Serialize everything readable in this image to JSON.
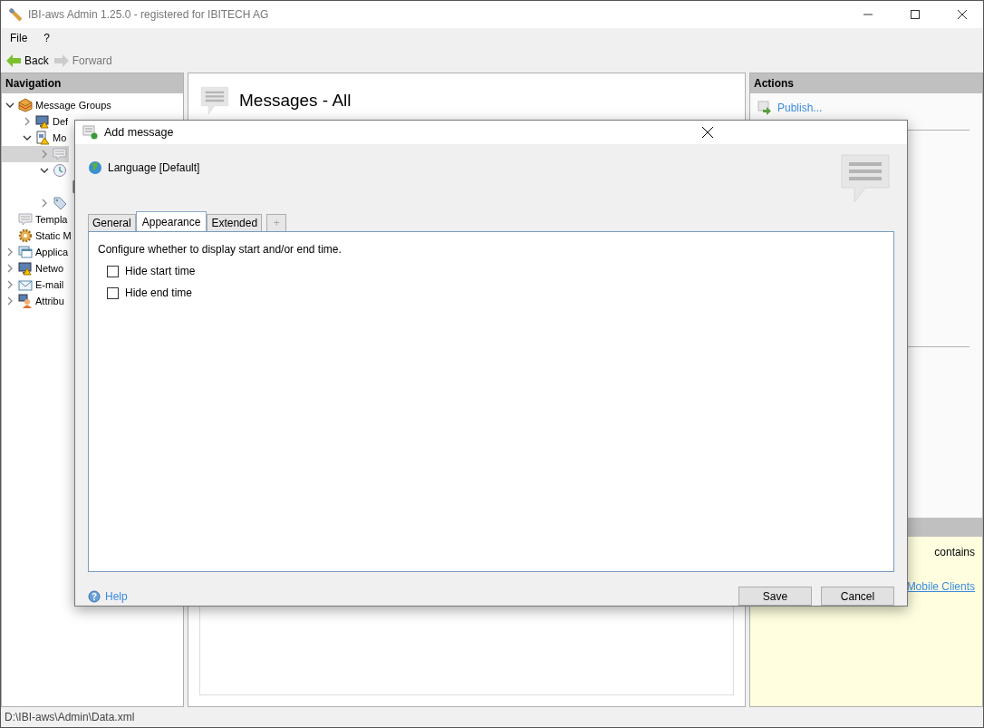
{
  "window": {
    "title": "IBI-aws Admin 1.25.0 - registered for IBITECH AG"
  },
  "menu": [
    "File",
    "?"
  ],
  "toolbar": [
    {
      "label": "Back",
      "disabled": false
    },
    {
      "label": "Forward",
      "disabled": true
    }
  ],
  "navigation": {
    "title": "Navigation",
    "items": [
      {
        "label": "Message Groups",
        "expanded": true,
        "selected": false,
        "children": [
          {
            "label": "Def",
            "expanded": false,
            "selected": false
          },
          {
            "label": "Mo",
            "expanded": true,
            "selected": false,
            "children": [
              {
                "expanded": false,
                "selected": true
              },
              {
                "expanded": true,
                "selected": false,
                "children": [
                  {
                    "selected": false
                  }
                ]
              },
              {
                "expanded": false,
                "selected": false
              }
            ]
          }
        ]
      },
      {
        "label": "Templa",
        "selected": false
      },
      {
        "label": "Static M",
        "selected": false
      },
      {
        "label": "Applica",
        "expanded": false,
        "selected": false
      },
      {
        "label": "Netwo",
        "expanded": false,
        "selected": false
      },
      {
        "label": "E-mail",
        "expanded": false,
        "selected": false
      },
      {
        "label": "Attribu",
        "expanded": false,
        "selected": false
      }
    ]
  },
  "content": {
    "title": "Messages - All"
  },
  "actions": {
    "title": "Actions",
    "items": [
      "Publish..."
    ]
  },
  "info_panel": {
    "line_1": "contains",
    "link": "Mobile Clients"
  },
  "status_bar": "D:\\IBI-aws\\Admin\\Data.xml",
  "dialog": {
    "title": "Add message",
    "language": "Language [Default]",
    "tabs": [
      {
        "label": "General",
        "selected": false
      },
      {
        "label": "Appearance",
        "selected": true
      },
      {
        "label": "Extended",
        "selected": false
      },
      {
        "label": "+",
        "selected": false,
        "disabled": true
      }
    ],
    "description": "Configure whether to display start and/or end time.",
    "options": [
      {
        "label": "Hide start time",
        "checked": false
      },
      {
        "label": "Hide end time",
        "checked": false
      }
    ],
    "help": "Help",
    "buttons": [
      "Save",
      "Cancel"
    ]
  }
}
